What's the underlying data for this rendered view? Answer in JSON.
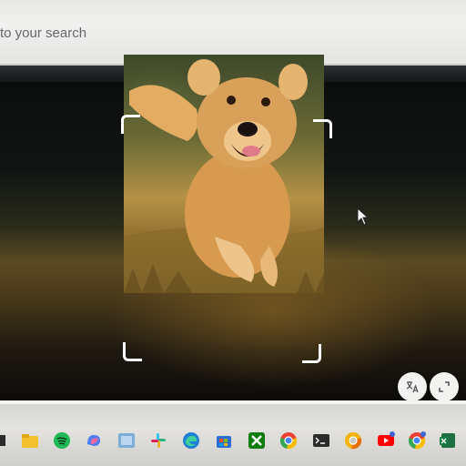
{
  "search": {
    "text": "to your search"
  },
  "viewer": {
    "image_icon": "dog-photo-icon",
    "buttons": {
      "translate_icon": "translate-icon",
      "expand_icon": "expand-icon"
    }
  },
  "taskbar": {
    "apps": [
      {
        "icon": "pinned-app-icon"
      },
      {
        "icon": "file-explorer-icon"
      },
      {
        "icon": "spotify-icon"
      },
      {
        "icon": "copilot-icon"
      },
      {
        "icon": "image-app-icon"
      },
      {
        "icon": "slack-icon"
      },
      {
        "icon": "edge-icon"
      },
      {
        "icon": "store-icon"
      },
      {
        "icon": "xbox-icon"
      },
      {
        "icon": "chrome-icon"
      },
      {
        "icon": "terminal-icon"
      },
      {
        "icon": "chrome-canary-icon"
      },
      {
        "icon": "youtube-icon"
      },
      {
        "icon": "chrome-notification-icon"
      },
      {
        "icon": "excel-icon"
      }
    ]
  },
  "colors": {
    "accent_blue": "#1a73e8",
    "spotify": "#1db954",
    "youtube": "#ff0000",
    "xbox": "#107c10",
    "excel": "#1d6f42"
  }
}
